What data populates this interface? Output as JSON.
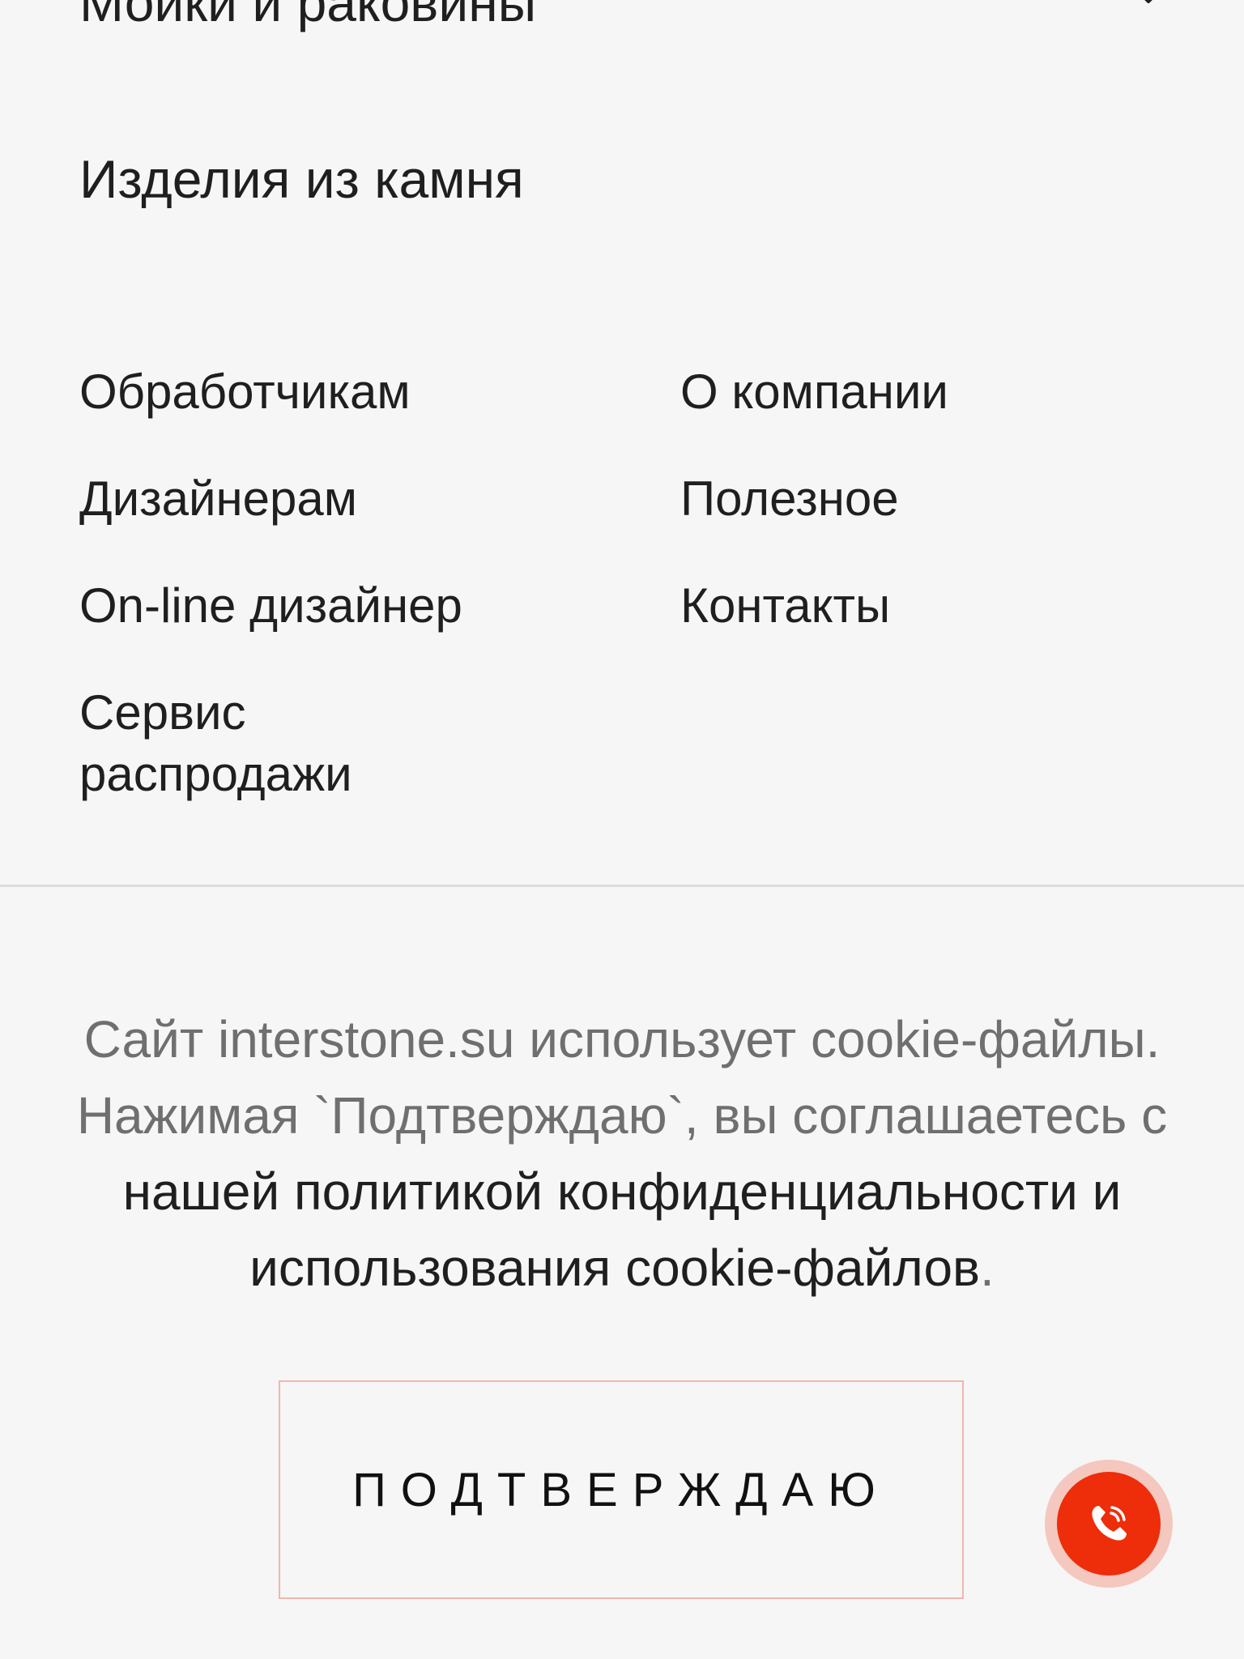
{
  "categories": [
    {
      "label": "Мойки и раковины",
      "has_chevron": true
    },
    {
      "label": "Изделия из камня",
      "has_chevron": false
    }
  ],
  "footer_nav": {
    "left": [
      {
        "label": "Обработчикам"
      },
      {
        "label": "Дизайнерам"
      },
      {
        "label": "On-line дизайнер"
      },
      {
        "label": "Сервис распродажи"
      }
    ],
    "right": [
      {
        "label": "О компании"
      },
      {
        "label": "Полезное"
      },
      {
        "label": "Контакты"
      }
    ]
  },
  "cookie_notice": {
    "text_before": "Сайт interstone.su использует cookie-файлы. Нажимая `Подтверждаю`, вы соглашаетесь с ",
    "link_text": "нашей политикой конфиденциальности и использования cookie-файлов",
    "text_after": ".",
    "confirm_label": "ПОДТВЕРЖДАЮ"
  },
  "icons": {
    "chevron": "chevron-down-icon",
    "call": "phone-call-icon"
  },
  "colors": {
    "background": "#f6f6f6",
    "text": "#1f1f1f",
    "muted_text": "#6f6f6f",
    "accent": "#ee2d0a",
    "accent_halo": "#f4c7bf",
    "button_border": "#f0b7ae"
  }
}
